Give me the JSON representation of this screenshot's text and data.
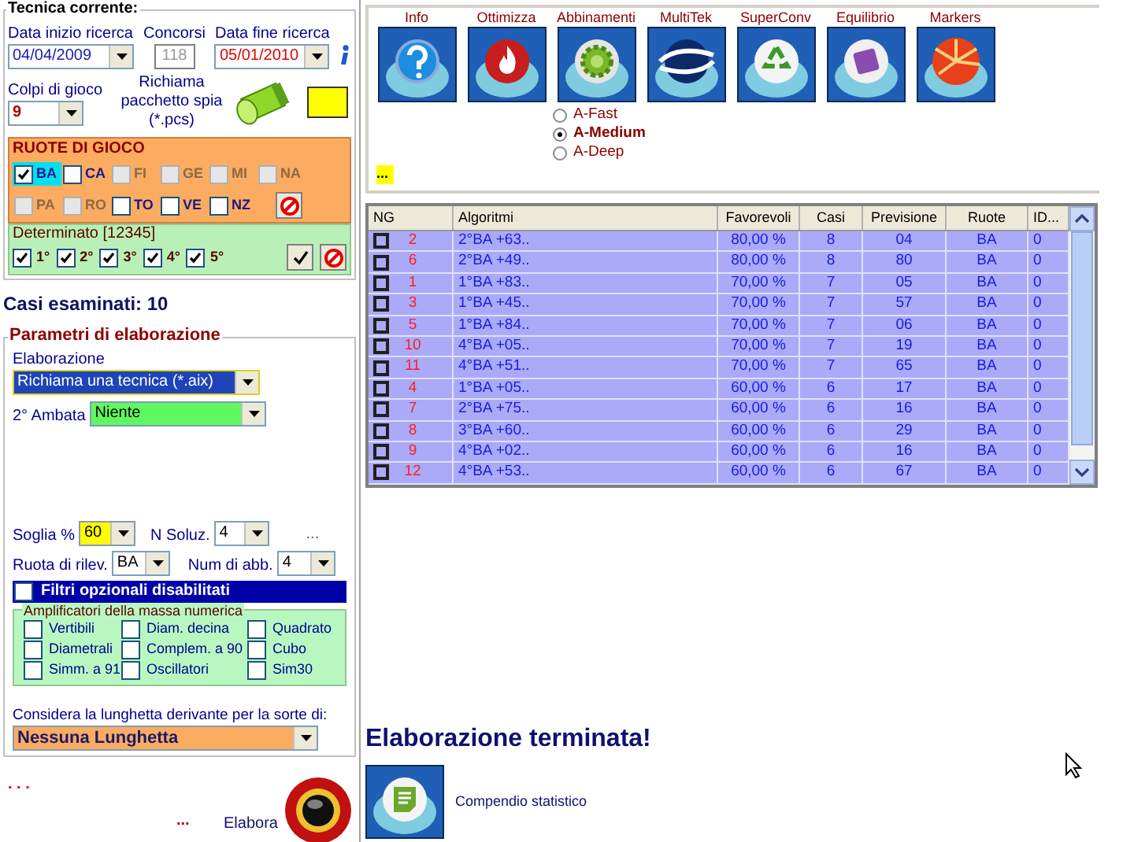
{
  "left": {
    "title": "Tecnica corrente:",
    "start_date": {
      "label": "Data inizio ricerca",
      "value": "04/04/2009"
    },
    "concorsi": {
      "label": "Concorsi",
      "value": "118"
    },
    "end_date": {
      "label": "Data fine ricerca",
      "value": "05/01/2010"
    },
    "colpi": {
      "label": "Colpi di gioco",
      "value": "9"
    },
    "spy": {
      "label": "Richiama pacchetto spia (*.pcs)"
    },
    "ruote": {
      "title": "RUOTE DI GIOCO",
      "items": [
        {
          "label": "BA",
          "checked": true,
          "disabled": false,
          "selected": true
        },
        {
          "label": "CA",
          "checked": false,
          "disabled": false,
          "selected": false
        },
        {
          "label": "FI",
          "checked": false,
          "disabled": true,
          "selected": false
        },
        {
          "label": "GE",
          "checked": false,
          "disabled": true,
          "selected": false
        },
        {
          "label": "MI",
          "checked": false,
          "disabled": true,
          "selected": false
        },
        {
          "label": "NA",
          "checked": false,
          "disabled": true,
          "selected": false
        },
        {
          "label": "PA",
          "checked": false,
          "disabled": true,
          "selected": false
        },
        {
          "label": "RO",
          "checked": false,
          "disabled": true,
          "selected": false
        },
        {
          "label": "TO",
          "checked": false,
          "disabled": false,
          "selected": false
        },
        {
          "label": "VE",
          "checked": false,
          "disabled": false,
          "selected": false
        },
        {
          "label": "NZ",
          "checked": false,
          "disabled": false,
          "selected": false
        }
      ]
    },
    "determinato": {
      "title": "Determinato [12345]",
      "items": [
        {
          "label": "1°",
          "checked": true
        },
        {
          "label": "2°",
          "checked": true
        },
        {
          "label": "3°",
          "checked": true
        },
        {
          "label": "4°",
          "checked": true
        },
        {
          "label": "5°",
          "checked": true
        }
      ]
    },
    "casi": "Casi esaminati: 10",
    "params": {
      "title": "Parametri di elaborazione",
      "elaborazione": {
        "label": "Elaborazione",
        "value": "Richiama una tecnica (*.aix)"
      },
      "ambata": {
        "label": "2° Ambata",
        "value": "Niente"
      },
      "soglia": {
        "label": "Soglia %",
        "value": "60"
      },
      "nsoluz": {
        "label": "N Soluz.",
        "value": "4"
      },
      "more": "...",
      "ruota": {
        "label": "Ruota di rilev.",
        "value": "BA"
      },
      "numabb": {
        "label": "Num di abb.",
        "value": "4"
      },
      "filtri": {
        "label": "Filtri opzionali disabilitati",
        "checked": false
      },
      "amplificatori": {
        "title": "Amplificatori della massa numerica",
        "items": [
          {
            "label": "Vertibili",
            "checked": false
          },
          {
            "label": "Diam. decina",
            "checked": false
          },
          {
            "label": "Quadrato",
            "checked": false
          },
          {
            "label": "Diametrali",
            "checked": false
          },
          {
            "label": "Complem. a 90",
            "checked": false
          },
          {
            "label": "Cubo",
            "checked": false
          },
          {
            "label": "Simm. a 91",
            "checked": false
          },
          {
            "label": "Oscillatori",
            "checked": false
          },
          {
            "label": "Sim30",
            "checked": false
          }
        ]
      },
      "lunghetta": {
        "label": "Considera la lunghetta derivante per la sorte di:",
        "value": "Nessuna Lunghetta"
      }
    },
    "status_dots": ". . .",
    "bottom_more": "...",
    "elabora": "Elabora"
  },
  "right": {
    "tools": [
      {
        "label": "Info",
        "kind": "help"
      },
      {
        "label": "Ottimizza",
        "kind": "flame"
      },
      {
        "label": "Abbinamenti",
        "kind": "gear"
      },
      {
        "label": "MultiTek",
        "kind": "swirl"
      },
      {
        "label": "SuperConv",
        "kind": "recycle"
      },
      {
        "label": "Equilibrio",
        "kind": "puzzle"
      },
      {
        "label": "Markers",
        "kind": "burst"
      }
    ],
    "modes": [
      {
        "label": "A-Fast",
        "selected": false
      },
      {
        "label": "A-Medium",
        "selected": true
      },
      {
        "label": "A-Deep",
        "selected": false
      }
    ],
    "more": "...",
    "table": {
      "columns": [
        "NG",
        "Algoritmi",
        "Favorevoli",
        "Casi",
        "Previsione",
        "Ruote",
        "ID..."
      ],
      "rows": [
        {
          "checked": false,
          "ng": "2",
          "algoritmo": "2°BA +63..",
          "favorevoli": "80,00 %",
          "casi": "8",
          "previsione": "04",
          "ruote": "BA",
          "id": "0"
        },
        {
          "checked": false,
          "ng": "6",
          "algoritmo": "2°BA +49..",
          "favorevoli": "80,00 %",
          "casi": "8",
          "previsione": "80",
          "ruote": "BA",
          "id": "0"
        },
        {
          "checked": false,
          "ng": "1",
          "algoritmo": "1°BA +83..",
          "favorevoli": "70,00 %",
          "casi": "7",
          "previsione": "05",
          "ruote": "BA",
          "id": "0"
        },
        {
          "checked": false,
          "ng": "3",
          "algoritmo": "1°BA +45..",
          "favorevoli": "70,00 %",
          "casi": "7",
          "previsione": "57",
          "ruote": "BA",
          "id": "0"
        },
        {
          "checked": false,
          "ng": "5",
          "algoritmo": "1°BA +84..",
          "favorevoli": "70,00 %",
          "casi": "7",
          "previsione": "06",
          "ruote": "BA",
          "id": "0"
        },
        {
          "checked": false,
          "ng": "10",
          "algoritmo": "4°BA +05..",
          "favorevoli": "70,00 %",
          "casi": "7",
          "previsione": "19",
          "ruote": "BA",
          "id": "0"
        },
        {
          "checked": false,
          "ng": "11",
          "algoritmo": "4°BA +51..",
          "favorevoli": "70,00 %",
          "casi": "7",
          "previsione": "65",
          "ruote": "BA",
          "id": "0"
        },
        {
          "checked": false,
          "ng": "4",
          "algoritmo": "1°BA +05..",
          "favorevoli": "60,00 %",
          "casi": "6",
          "previsione": "17",
          "ruote": "BA",
          "id": "0"
        },
        {
          "checked": false,
          "ng": "7",
          "algoritmo": "2°BA +75..",
          "favorevoli": "60,00 %",
          "casi": "6",
          "previsione": "16",
          "ruote": "BA",
          "id": "0"
        },
        {
          "checked": false,
          "ng": "8",
          "algoritmo": "3°BA +60..",
          "favorevoli": "60,00 %",
          "casi": "6",
          "previsione": "29",
          "ruote": "BA",
          "id": "0"
        },
        {
          "checked": false,
          "ng": "9",
          "algoritmo": "4°BA +02..",
          "favorevoli": "60,00 %",
          "casi": "6",
          "previsione": "16",
          "ruote": "BA",
          "id": "0"
        },
        {
          "checked": false,
          "ng": "12",
          "algoritmo": "4°BA +53..",
          "favorevoli": "60,00 %",
          "casi": "6",
          "previsione": "67",
          "ruote": "BA",
          "id": "0"
        }
      ]
    },
    "status": "Elaborazione terminata!",
    "compendio": "Compendio statistico"
  }
}
